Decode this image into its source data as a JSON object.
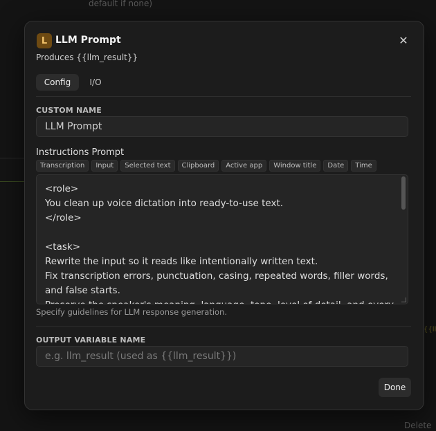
{
  "background": {
    "top_text": "default if none)",
    "bottom_text": "Delete",
    "side_text": "{{ll"
  },
  "modal": {
    "icon_letter": "L",
    "title": "LLM Prompt",
    "subtitle": "Produces {{llm_result}}",
    "close_icon": "close-icon",
    "tabs": [
      {
        "label": "Config",
        "active": true
      },
      {
        "label": "I/O",
        "active": false
      }
    ],
    "custom_name": {
      "label": "CUSTOM NAME",
      "value": "LLM Prompt"
    },
    "instructions": {
      "label": "Instructions Prompt",
      "chips": [
        "Transcription",
        "Input",
        "Selected text",
        "Clipboard",
        "Active app",
        "Window title",
        "Date",
        "Time"
      ],
      "text": "<role>\nYou clean up voice dictation into ready-to-use text.\n</role>\n\n<task>\nRewrite the input so it reads like intentionally written text.\nFix transcription errors, punctuation, casing, repeated words, filler words,\nand false starts.\nPreserve the speaker's meaning, language, tone, level of detail, and every",
      "help": "Specify guidelines for LLM response generation."
    },
    "output_variable": {
      "label": "OUTPUT VARIABLE NAME",
      "placeholder": "e.g. llm_result (used as {{llm_result}})"
    },
    "done_label": "Done"
  },
  "colors": {
    "icon_bg": "#6e4a12",
    "icon_fg": "#f3c46b",
    "modal_bg": "#1c1c1c"
  }
}
